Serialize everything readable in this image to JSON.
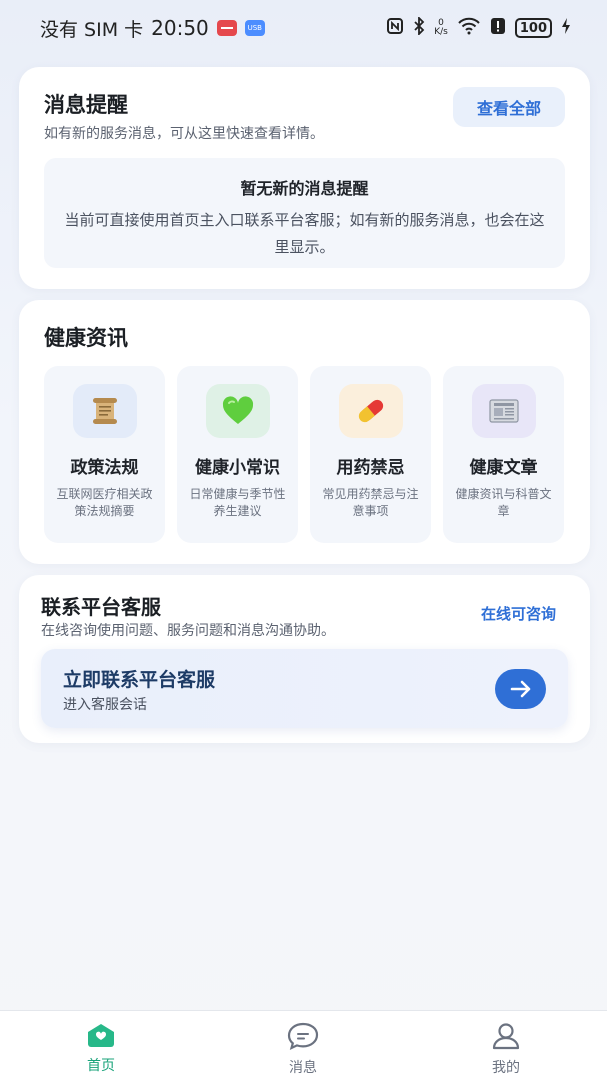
{
  "status_bar": {
    "carrier": "没有 SIM 卡",
    "time": "20:50",
    "usb_badge": "USB",
    "net_speed_value": "0",
    "net_speed_unit": "K/s",
    "battery": "100"
  },
  "notice": {
    "title": "消息提醒",
    "subtitle": "如有新的服务消息，可从这里快速查看详情。",
    "view_all_label": "查看全部",
    "empty_title": "暂无新的消息提醒",
    "empty_desc": "当前可直接使用首页主入口联系平台客服；如有新的服务消息，也会在这里显示。"
  },
  "health": {
    "title": "健康资讯",
    "tiles": [
      {
        "name": "政策法规",
        "desc": "互联网医疗相关政策法规摘要",
        "icon": "scroll-icon",
        "icon_bg": "#e3ebf9"
      },
      {
        "name": "健康小常识",
        "desc": "日常健康与季节性养生建议",
        "icon": "heart-icon",
        "icon_bg": "#dff1e6"
      },
      {
        "name": "用药禁忌",
        "desc": "常见用药禁忌与注意事项",
        "icon": "pill-icon",
        "icon_bg": "#fbefdc"
      },
      {
        "name": "健康文章",
        "desc": "健康资讯与科普文章",
        "icon": "newspaper-icon",
        "icon_bg": "#e8e6f8"
      }
    ]
  },
  "service": {
    "title": "联系平台客服",
    "subtitle": "在线咨询使用问题、服务问题和消息沟通协助。",
    "online_label": "在线可咨询",
    "contact_title": "立即联系平台客服",
    "contact_sub": "进入客服会话"
  },
  "nav": {
    "items": [
      {
        "label": "首页",
        "icon": "home-icon",
        "active": true
      },
      {
        "label": "消息",
        "icon": "message-icon",
        "active": false
      },
      {
        "label": "我的",
        "icon": "profile-icon",
        "active": false
      }
    ]
  },
  "colors": {
    "accent_blue": "#2f6fd6",
    "accent_green": "#19a37a"
  }
}
